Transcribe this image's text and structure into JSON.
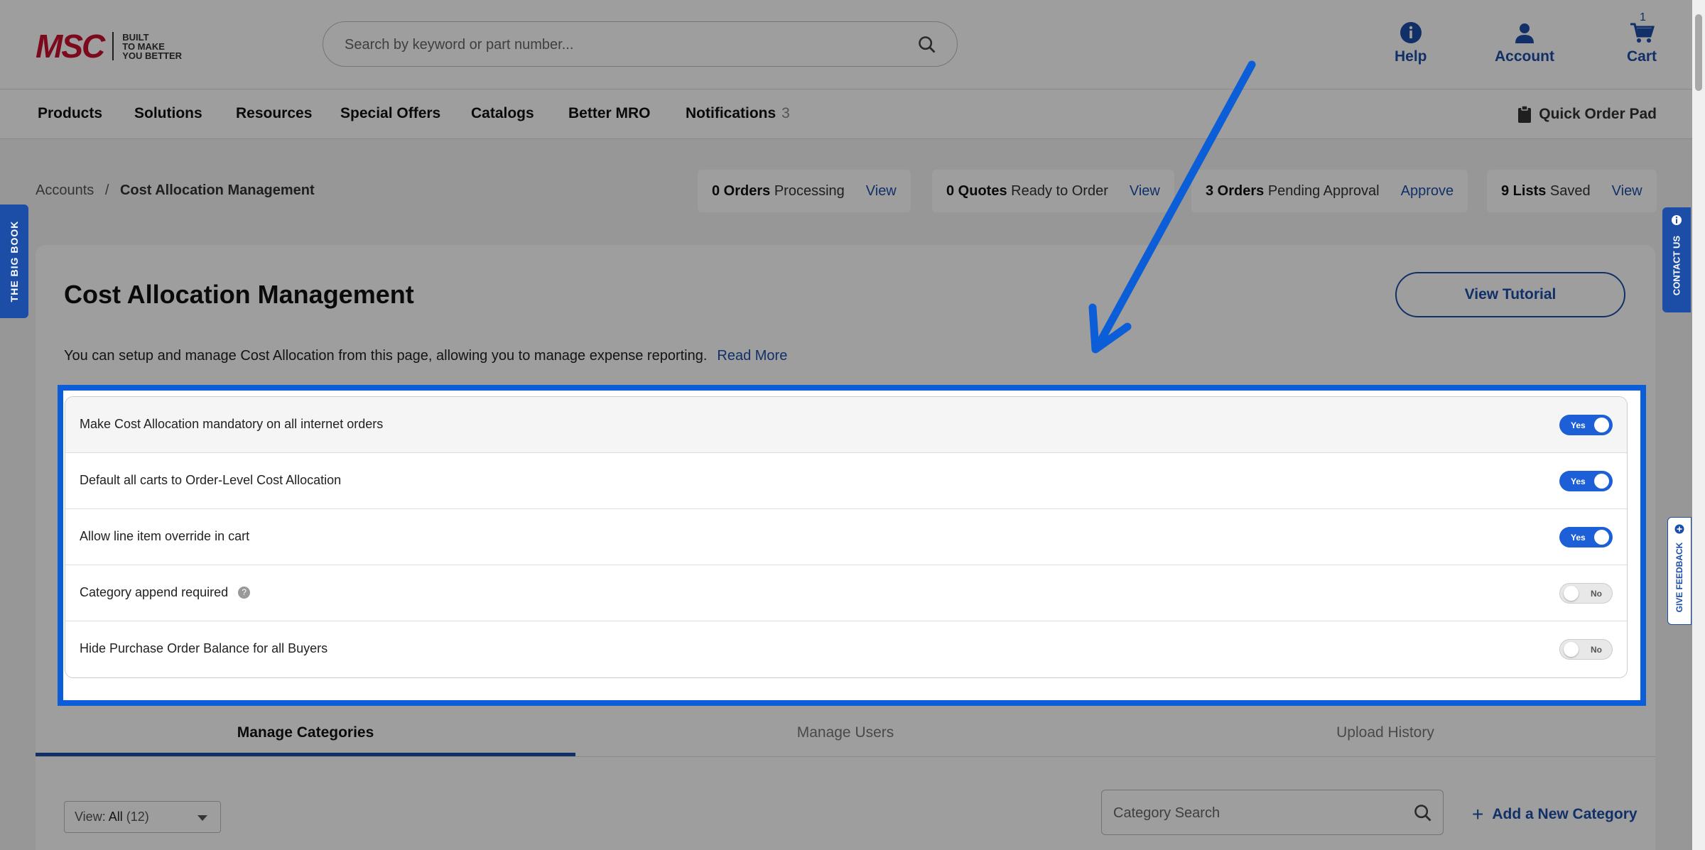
{
  "header": {
    "logo_brand": "MSC",
    "logo_tagline": [
      "BUILT",
      "TO MAKE",
      "YOU BETTER"
    ],
    "search_placeholder": "Search by keyword or part number...",
    "help_label": "Help",
    "account_label": "Account",
    "cart_label": "Cart",
    "cart_count": "1"
  },
  "nav": {
    "items": [
      "Products",
      "Solutions",
      "Resources",
      "Special Offers",
      "Catalogs",
      "Better MRO",
      "Notifications"
    ],
    "notifications_count": "3",
    "quick_order_label": "Quick Order Pad"
  },
  "breadcrumb": {
    "parent": "Accounts",
    "separator": "/",
    "current": "Cost Allocation Management"
  },
  "stats": [
    {
      "bold": "0 Orders",
      "text": "Processing",
      "link": "View"
    },
    {
      "bold": "0 Quotes",
      "text": "Ready to Order",
      "link": "View"
    },
    {
      "bold": "3 Orders",
      "text": "Pending Approval",
      "link": "Approve"
    },
    {
      "bold": "9 Lists",
      "text": "Saved",
      "link": "View"
    }
  ],
  "page": {
    "title": "Cost Allocation Management",
    "tutorial_button": "View Tutorial",
    "description": "You can setup and manage Cost Allocation from this page, allowing you to manage expense reporting.",
    "read_more": "Read More"
  },
  "settings": [
    {
      "label": "Make Cost Allocation mandatory on all internet orders",
      "state": "Yes",
      "on": true
    },
    {
      "label": "Default all carts to Order-Level Cost Allocation",
      "state": "Yes",
      "on": true
    },
    {
      "label": "Allow line item override in cart",
      "state": "Yes",
      "on": true
    },
    {
      "label": "Category append required",
      "state": "No",
      "on": false,
      "help": "?"
    },
    {
      "label": "Hide Purchase Order Balance for all Buyers",
      "state": "No",
      "on": false
    }
  ],
  "tabs": [
    "Manage Categories",
    "Manage Users",
    "Upload History"
  ],
  "active_tab": "Manage Categories",
  "filters": {
    "view_prefix": "View:",
    "view_value": "All",
    "view_count": "(12)",
    "category_search_placeholder": "Category Search",
    "add_category": "Add a New Category"
  },
  "side_tabs": {
    "big_book": "THE BIG BOOK",
    "contact_us": "CONTACT US",
    "give_feedback": "GIVE FEEDBACK"
  },
  "colors": {
    "brand_red": "#c8102e",
    "accent_blue": "#1c4ea8",
    "toggle_on": "#1c5fd6",
    "highlight_blue": "#0b5ed7"
  }
}
